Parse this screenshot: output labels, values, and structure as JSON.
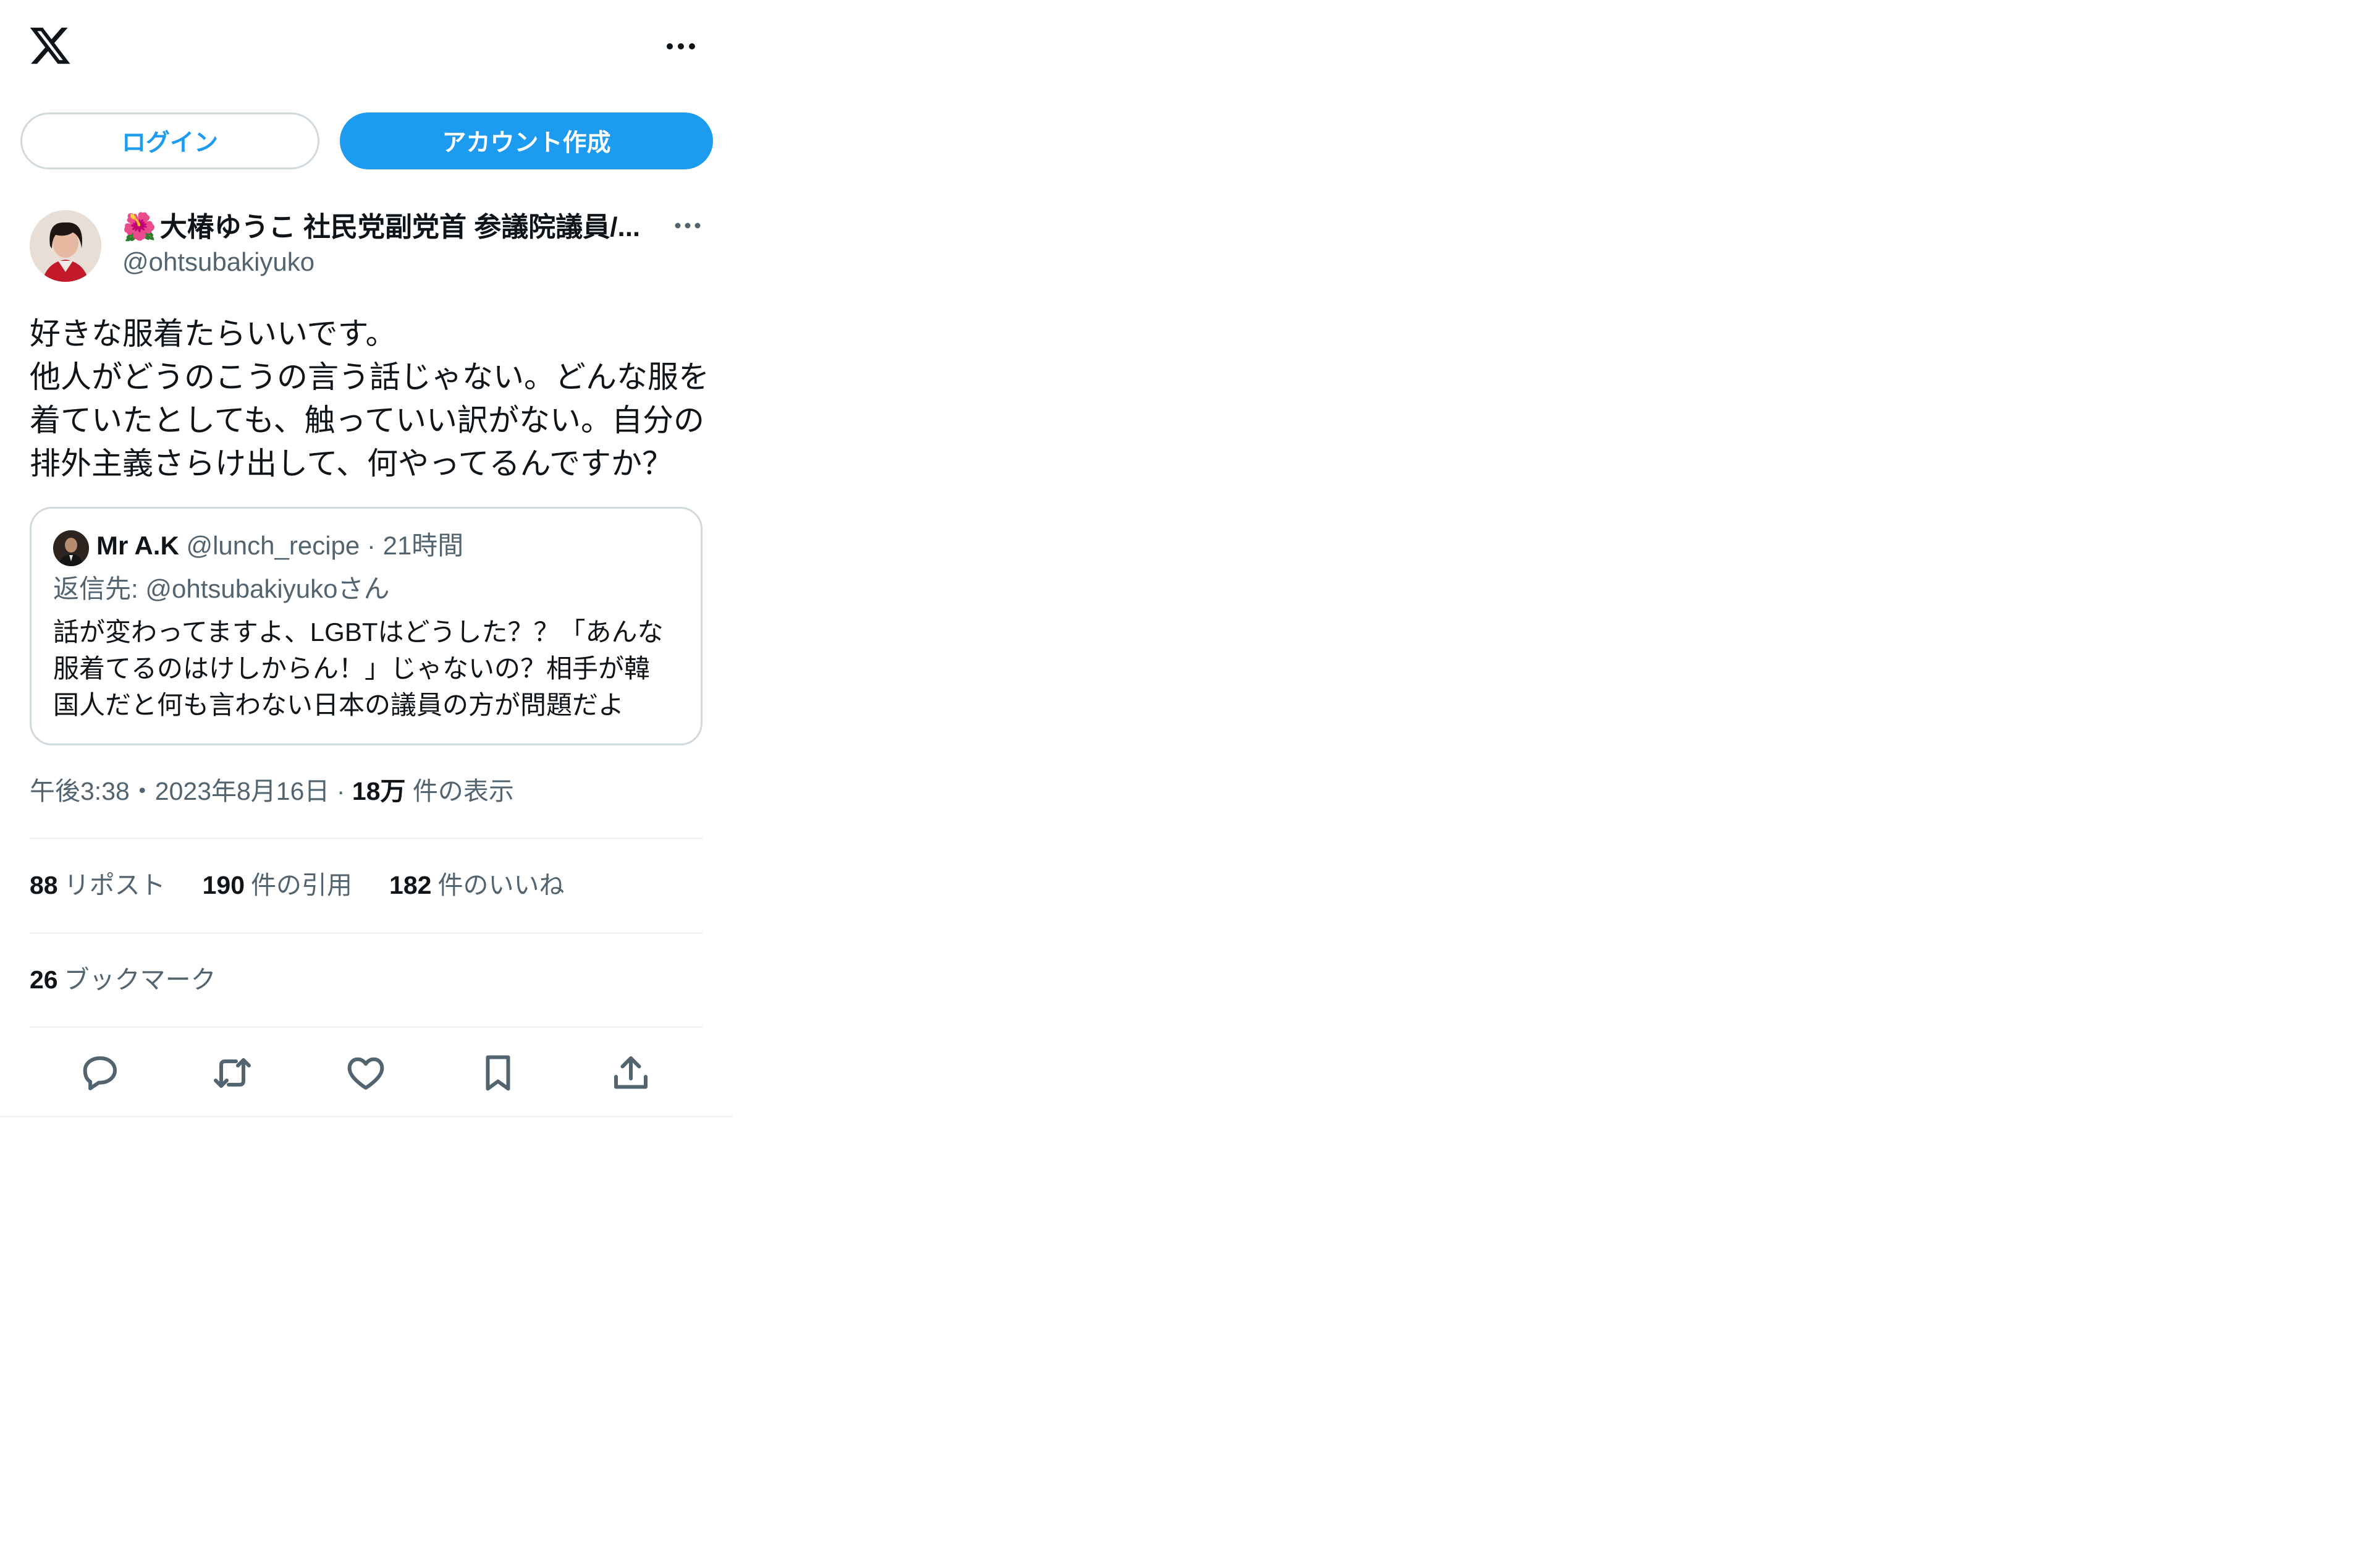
{
  "header": {
    "logo_icon": "x-logo-icon",
    "more_icon": "more-horizontal-icon"
  },
  "auth": {
    "login_label": "ログイン",
    "signup_label": "アカウント作成",
    "accent_color": "#1d9bf0"
  },
  "tweet": {
    "author": {
      "emoji": "🌺",
      "name": "大椿ゆうこ 社民党副党首 参議院議員/...",
      "handle": "@ohtsubakiyuko"
    },
    "text_lines": [
      "好きな服着たらいいです。",
      "他人がどうのこうの言う話じゃない。どんな服を",
      "着ていたとしても、触っていい訳がない。自分の",
      "排外主義さらけ出して、何やってるんですか？"
    ],
    "quote": {
      "name": "Mr A.K",
      "handle": "@lunch_recipe",
      "separator": "·",
      "time": "21時間",
      "reply_to": "返信先: @ohtsubakiyukoさん",
      "body_lines": [
        "話が変わってますよ、LGBTはどうした？？「あんな",
        "服着てるのはけしからん！」じゃないの？相手が韓",
        "国人だと何も言わない日本の議員の方が問題だよ"
      ]
    },
    "timestamp": "午後3:38・2023年8月16日",
    "separator": "·",
    "views_count": "18万",
    "views_label": "件の表示",
    "stats": {
      "reposts_count": "88",
      "reposts_label": "リポスト",
      "quotes_count": "190",
      "quotes_label": "件の引用",
      "likes_count": "182",
      "likes_label": "件のいいね",
      "bookmarks_count": "26",
      "bookmarks_label": "ブックマーク"
    },
    "actions": [
      "reply-icon",
      "repost-icon",
      "like-icon",
      "bookmark-icon",
      "share-icon"
    ]
  }
}
